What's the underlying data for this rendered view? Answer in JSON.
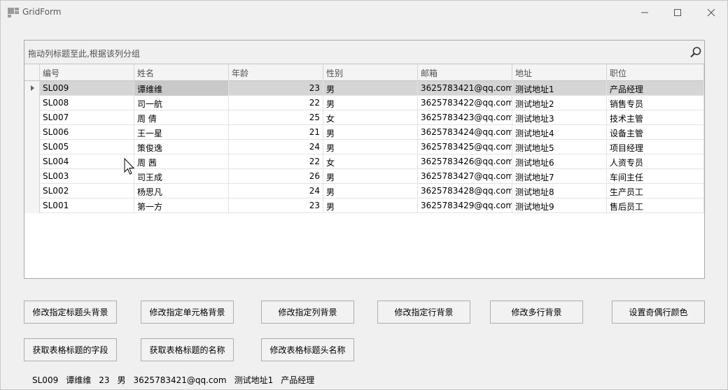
{
  "window": {
    "title": "GridForm"
  },
  "grid": {
    "group_panel_text": "拖动列标题至此,根据该列分组",
    "columns": [
      "编号",
      "姓名",
      "年龄",
      "性别",
      "邮箱",
      "地址",
      "职位"
    ],
    "rows": [
      [
        "SL009",
        "谭维维",
        "23",
        "男",
        "3625783421@qq.com",
        "测试地址1",
        "产品经理"
      ],
      [
        "SL008",
        "司一航",
        "22",
        "男",
        "3625783422@qq.com",
        "测试地址2",
        "销售专员"
      ],
      [
        "SL007",
        "周  倩",
        "25",
        "女",
        "3625783423@qq.com",
        "测试地址3",
        "技术主管"
      ],
      [
        "SL006",
        "王一星",
        "21",
        "男",
        "3625783424@qq.com",
        "测试地址4",
        "设备主管"
      ],
      [
        "SL005",
        "策俊逸",
        "24",
        "男",
        "3625783425@qq.com",
        "测试地址5",
        "项目经理"
      ],
      [
        "SL004",
        "周  茜",
        "22",
        "女",
        "3625783426@qq.com",
        "测试地址6",
        "人资专员"
      ],
      [
        "SL003",
        "司王成",
        "26",
        "男",
        "3625783427@qq.com",
        "测试地址7",
        "车间主任"
      ],
      [
        "SL002",
        "杨思凡",
        "24",
        "男",
        "3625783428@qq.com",
        "测试地址8",
        "生产员工"
      ],
      [
        "SL001",
        "第一方",
        "23",
        "男",
        "3625783429@qq.com",
        "测试地址9",
        "售后员工"
      ]
    ]
  },
  "buttons": {
    "row1": [
      "修改指定标题头背景",
      "修改指定单元格背景",
      "修改指定列背景",
      "修改指定行背景",
      "修改多行背景",
      "设置奇偶行颜色"
    ],
    "row2": [
      "获取表格标题的字段",
      "获取表格标题的名称",
      "修改表格标题头名称"
    ]
  },
  "status": [
    "SL009",
    "谭维维",
    "23",
    "男",
    "3625783421@qq.com",
    "测试地址1",
    "产品经理"
  ]
}
